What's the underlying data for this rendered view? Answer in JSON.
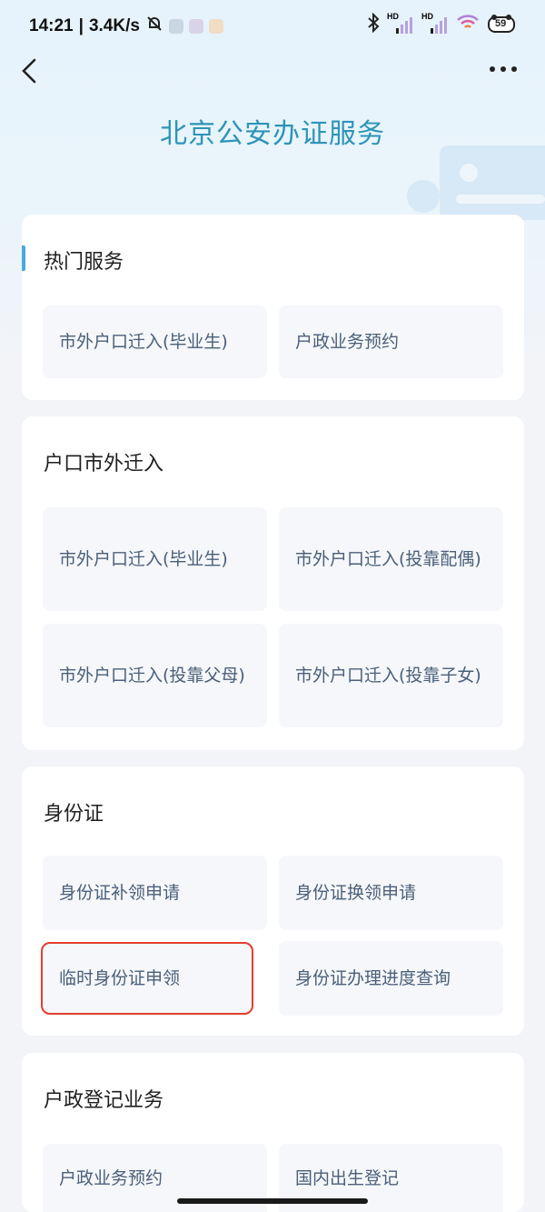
{
  "status_bar": {
    "time": "14:21",
    "speed": "3.4K/s",
    "battery": "59",
    "signal_hd_1": "HD",
    "signal_hd_2": "HD"
  },
  "header": {
    "title": "北京公安办证服务"
  },
  "sections": {
    "hot": {
      "title": "热门服务",
      "items": [
        "市外户口迁入(毕业生)",
        "户政业务预约"
      ]
    },
    "hukou": {
      "title": "户口市外迁入",
      "items": [
        "市外户口迁入(毕业生)",
        "市外户口迁入(投靠配偶)",
        "市外户口迁入(投靠父母)",
        "市外户口迁入(投靠子女)"
      ]
    },
    "idcard": {
      "title": "身份证",
      "items": [
        "身份证补领申请",
        "身份证换领申请",
        "临时身份证申领",
        "身份证办理进度查询"
      ]
    },
    "huzheng": {
      "title": "户政登记业务",
      "items": [
        "户政业务预约",
        "国内出生登记"
      ]
    }
  },
  "colors": {
    "title_color": "#2d94b8",
    "tile_text": "#4b5f7a",
    "highlight": "#e43d2f",
    "accent": "#4aa9de"
  }
}
